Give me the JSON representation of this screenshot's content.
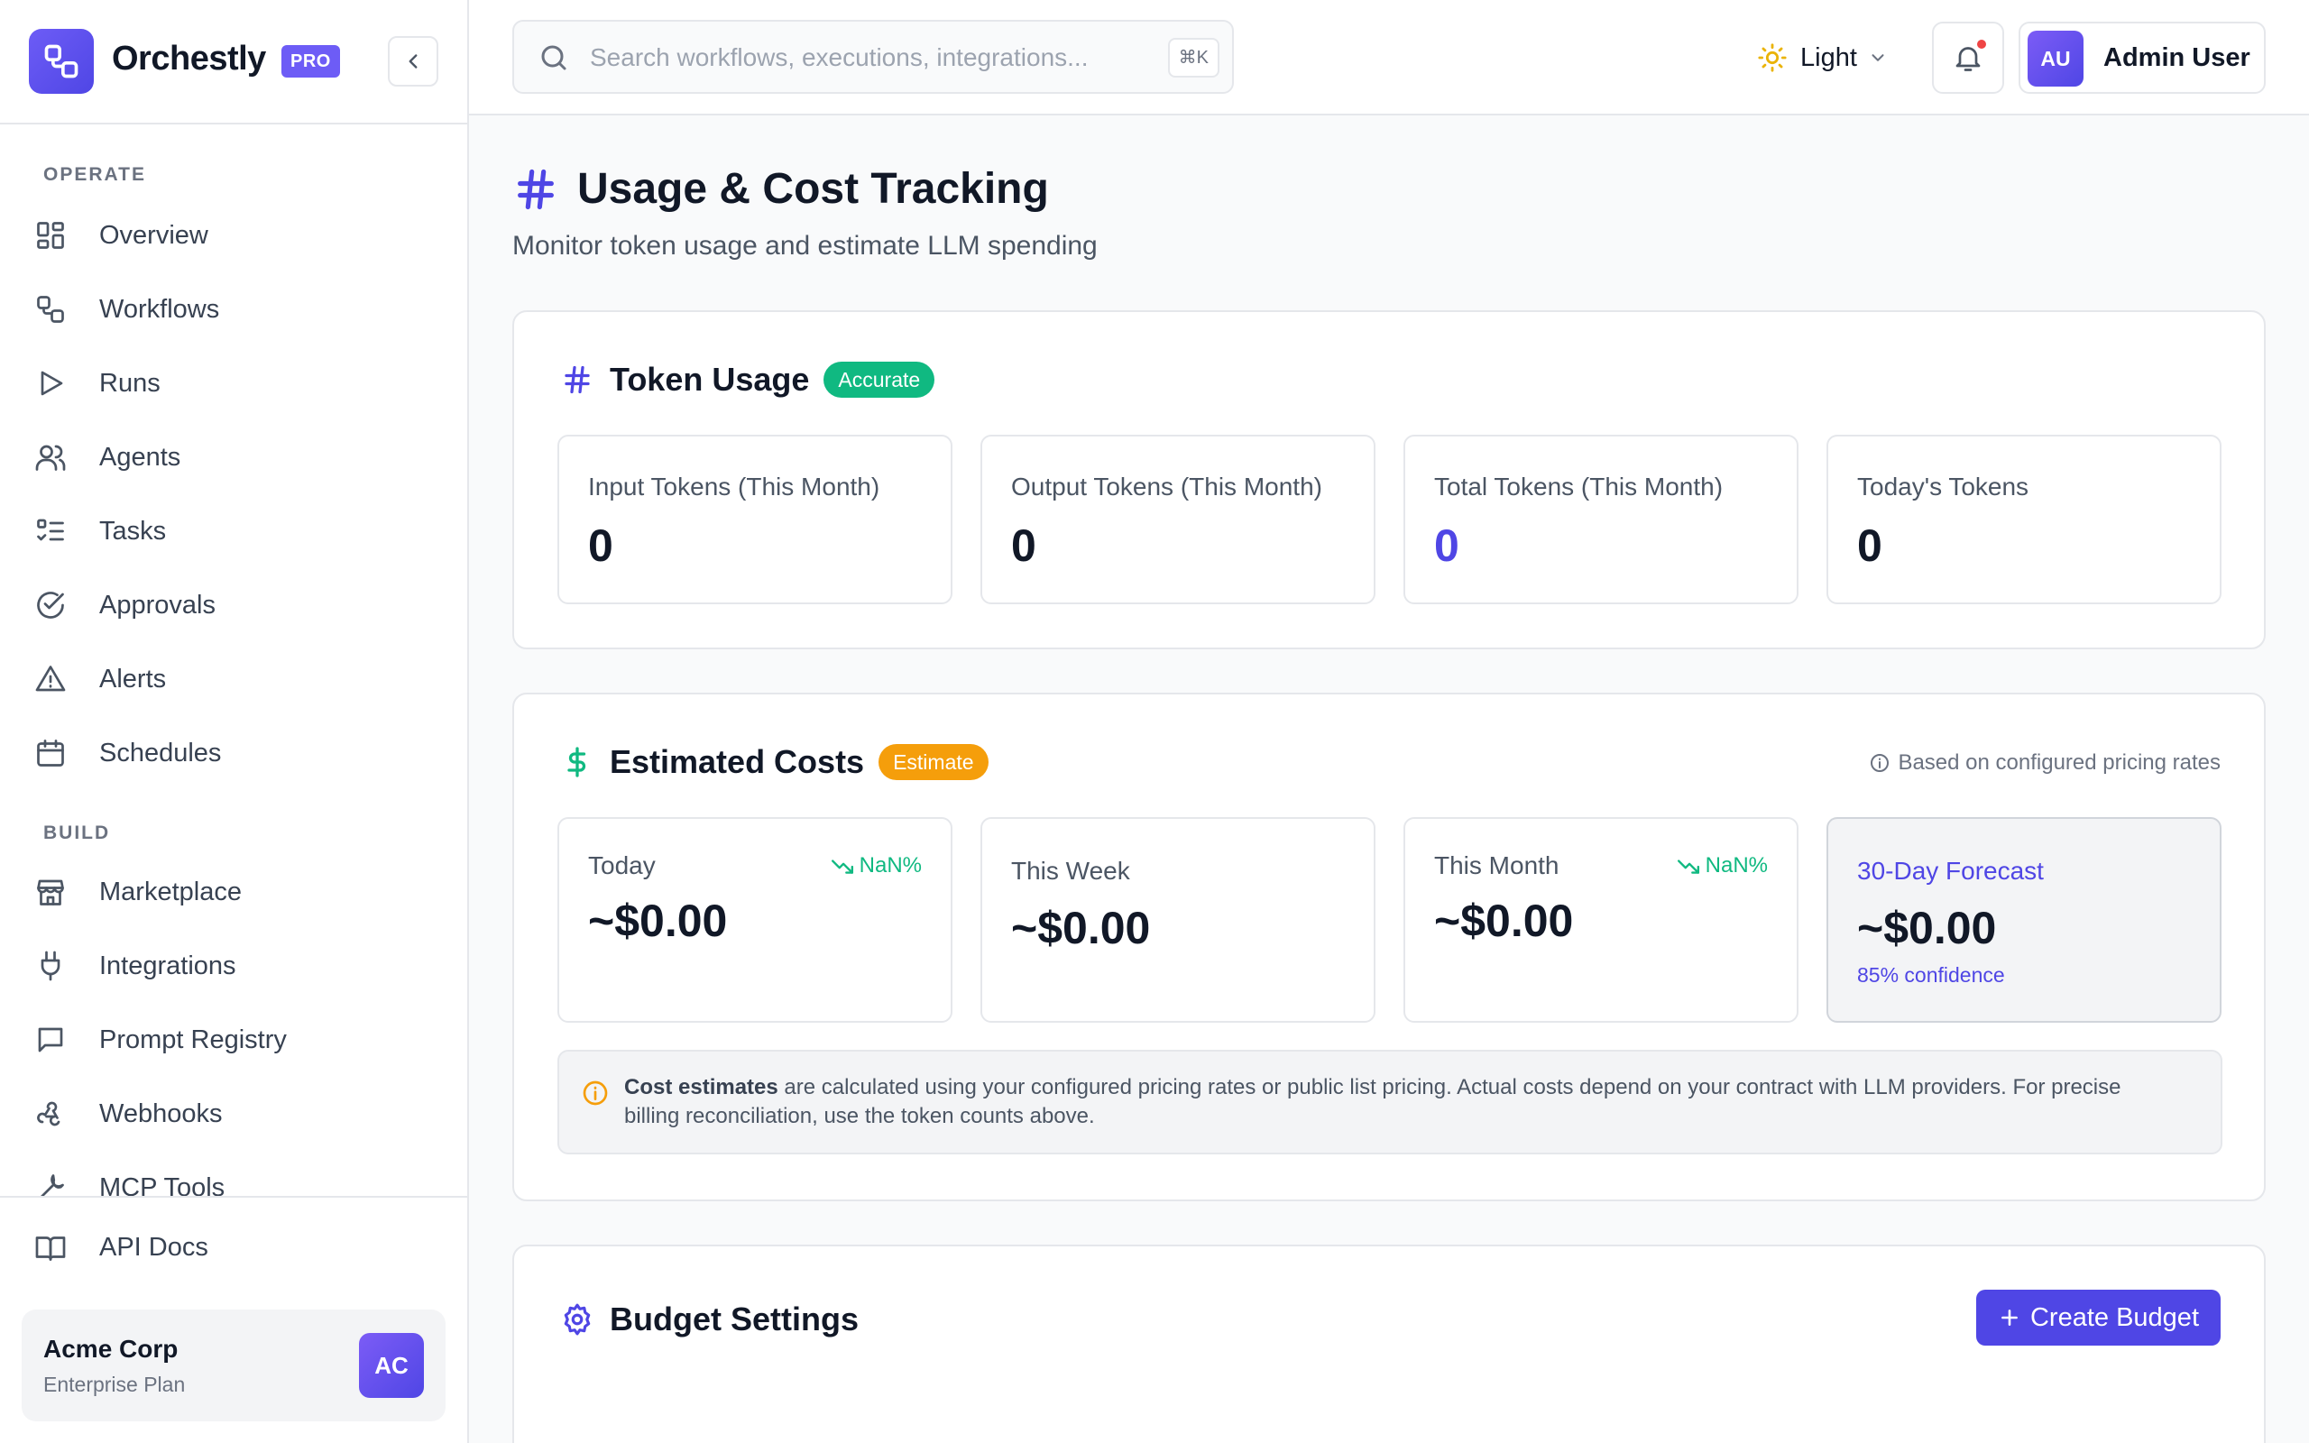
{
  "brand": {
    "name": "Orchestly",
    "tier": "PRO"
  },
  "sidebar": {
    "sections": [
      {
        "label": "OPERATE",
        "items": [
          {
            "label": "Overview",
            "icon": "grid-icon"
          },
          {
            "label": "Workflows",
            "icon": "workflow-icon"
          },
          {
            "label": "Runs",
            "icon": "play-icon"
          },
          {
            "label": "Agents",
            "icon": "users-icon"
          },
          {
            "label": "Tasks",
            "icon": "list-check-icon"
          },
          {
            "label": "Approvals",
            "icon": "check-circle-icon"
          },
          {
            "label": "Alerts",
            "icon": "alert-triangle-icon"
          },
          {
            "label": "Schedules",
            "icon": "calendar-icon"
          }
        ]
      },
      {
        "label": "BUILD",
        "items": [
          {
            "label": "Marketplace",
            "icon": "store-icon"
          },
          {
            "label": "Integrations",
            "icon": "plug-icon"
          },
          {
            "label": "Prompt Registry",
            "icon": "message-square-icon"
          },
          {
            "label": "Webhooks",
            "icon": "webhook-icon"
          },
          {
            "label": "MCP Tools",
            "icon": "wrench-icon"
          }
        ]
      }
    ],
    "api_docs": "API Docs",
    "org": {
      "name": "Acme Corp",
      "plan": "Enterprise Plan",
      "initials": "AC"
    }
  },
  "topbar": {
    "search_placeholder": "Search workflows, executions, integrations...",
    "search_value": "",
    "shortcut": "⌘K",
    "theme_label": "Light",
    "user": {
      "name": "Admin User",
      "initials": "AU"
    }
  },
  "page": {
    "title": "Usage & Cost Tracking",
    "subtitle": "Monitor token usage and estimate LLM spending"
  },
  "token_usage": {
    "title": "Token Usage",
    "badge": "Accurate",
    "stats": [
      {
        "label": "Input Tokens (This Month)",
        "value": "0"
      },
      {
        "label": "Output Tokens (This Month)",
        "value": "0"
      },
      {
        "label": "Total Tokens (This Month)",
        "value": "0"
      },
      {
        "label": "Today's Tokens",
        "value": "0"
      }
    ]
  },
  "estimated_costs": {
    "title": "Estimated Costs",
    "badge": "Estimate",
    "pricing_note": "Based on configured pricing rates",
    "stats": [
      {
        "label": "Today",
        "value": "~$0.00",
        "trend": "NaN%"
      },
      {
        "label": "This Week",
        "value": "~$0.00"
      },
      {
        "label": "This Month",
        "value": "~$0.00",
        "trend": "NaN%"
      },
      {
        "label": "30-Day Forecast",
        "value": "~$0.00",
        "extra": "85% confidence"
      }
    ],
    "note_bold": "Cost estimates",
    "note_text": " are calculated using your configured pricing rates or public list pricing. Actual costs depend on your contract with LLM providers. For precise billing reconciliation, use the token counts above."
  },
  "budget": {
    "title": "Budget Settings",
    "create_label": "Create Budget"
  },
  "colors": {
    "accent": "#4f46e5",
    "brand": "#6d5cf6",
    "success": "#10b981",
    "warning": "#f59e0b"
  }
}
